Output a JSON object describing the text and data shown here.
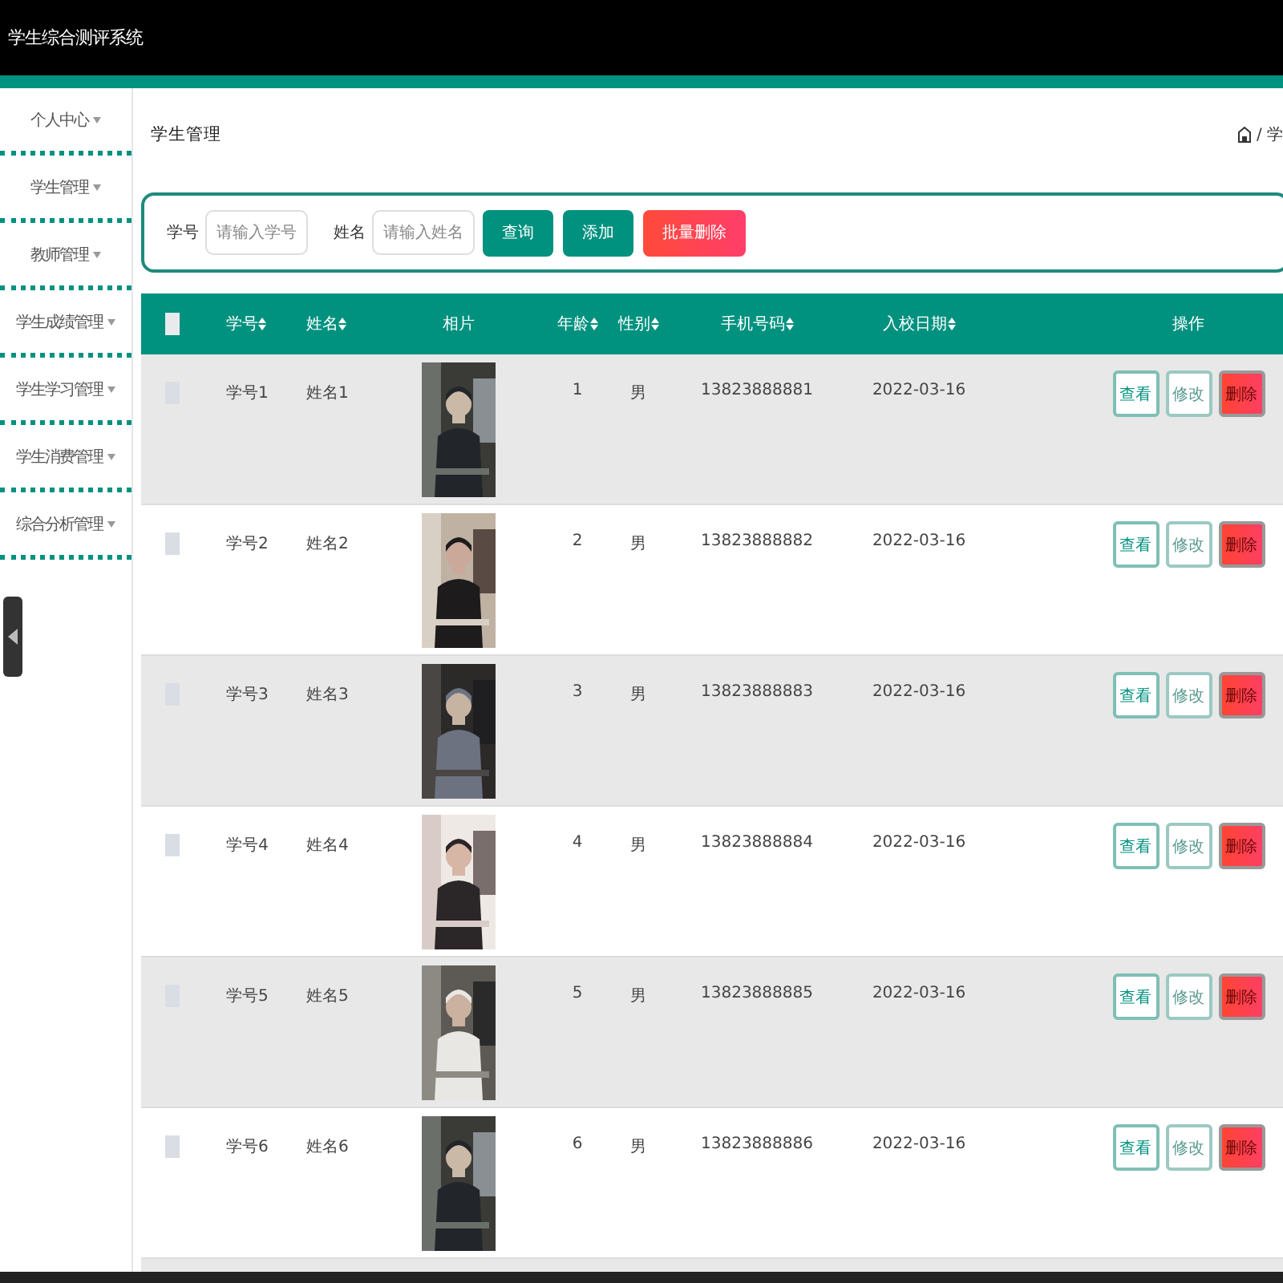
{
  "header": {
    "title": "学生综合测评系统"
  },
  "sidebar": {
    "items": [
      {
        "label": "个人中心"
      },
      {
        "label": "学生管理"
      },
      {
        "label": "教师管理"
      },
      {
        "label": "学生成绩管理"
      },
      {
        "label": "学生学习管理"
      },
      {
        "label": "学生消费管理"
      },
      {
        "label": "综合分析管理"
      }
    ]
  },
  "page_title": "学生管理",
  "breadcrumb": {
    "text": "/ 学"
  },
  "search": {
    "fields": [
      {
        "label": "学号",
        "placeholder": "请输入学号"
      },
      {
        "label": "姓名",
        "placeholder": "请输入姓名"
      }
    ],
    "buttons": [
      {
        "label": "查询",
        "kind": "primary"
      },
      {
        "label": "添加",
        "kind": "primary"
      },
      {
        "label": "批量删除",
        "kind": "danger"
      }
    ]
  },
  "table": {
    "select_all": {
      "checked": false
    },
    "columns": [
      {
        "label": "学号",
        "sortable": true
      },
      {
        "label": "姓名",
        "sortable": true
      },
      {
        "label": "相片",
        "sortable": false
      },
      {
        "label": "年龄",
        "sortable": true
      },
      {
        "label": "性别",
        "sortable": true
      },
      {
        "label": "手机号码",
        "sortable": true
      },
      {
        "label": "入校日期",
        "sortable": true
      },
      {
        "label": "操作",
        "sortable": false
      }
    ],
    "rows": [
      {
        "checked": false,
        "id": "学号1",
        "name": "姓名1",
        "age": "1",
        "sex": "男",
        "phone": "13823888881",
        "date": "2022-03-16",
        "actions": [
          "查看",
          "修改",
          "删除"
        ]
      },
      {
        "checked": false,
        "id": "学号2",
        "name": "姓名2",
        "age": "2",
        "sex": "男",
        "phone": "13823888882",
        "date": "2022-03-16",
        "actions": [
          "查看",
          "修改",
          "删除"
        ]
      },
      {
        "checked": false,
        "id": "学号3",
        "name": "姓名3",
        "age": "3",
        "sex": "男",
        "phone": "13823888883",
        "date": "2022-03-16",
        "actions": [
          "查看",
          "修改",
          "删除"
        ]
      },
      {
        "checked": false,
        "id": "学号4",
        "name": "姓名4",
        "age": "4",
        "sex": "男",
        "phone": "13823888884",
        "date": "2022-03-16",
        "actions": [
          "查看",
          "修改",
          "删除"
        ]
      },
      {
        "checked": false,
        "id": "学号5",
        "name": "姓名5",
        "age": "5",
        "sex": "男",
        "phone": "13823888885",
        "date": "2022-03-16",
        "actions": [
          "查看",
          "修改",
          "删除"
        ]
      },
      {
        "checked": false,
        "id": "学号6",
        "name": "姓名6",
        "age": "6",
        "sex": "男",
        "phone": "13823888886",
        "date": "2022-03-16",
        "actions": [
          "查看",
          "修改",
          "删除"
        ]
      }
    ]
  }
}
